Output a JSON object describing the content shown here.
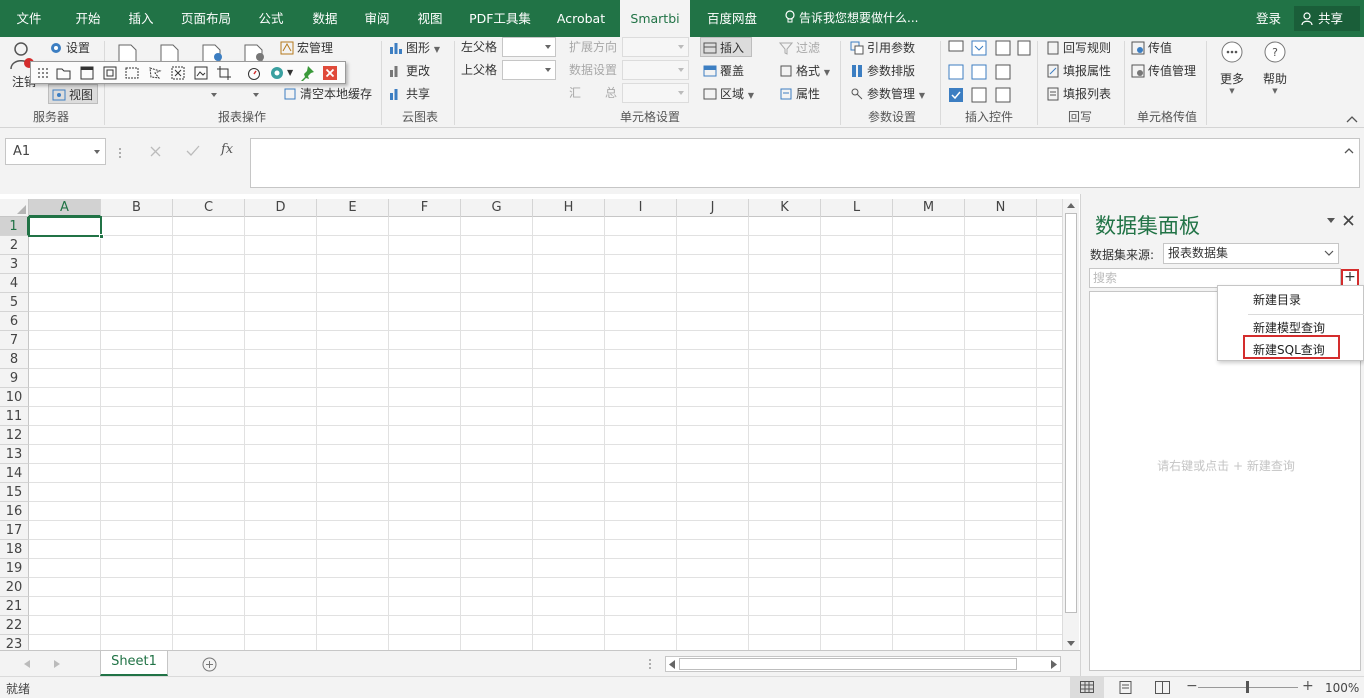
{
  "tabs": [
    "文件",
    "开始",
    "插入",
    "页面布局",
    "公式",
    "数据",
    "审阅",
    "视图",
    "PDF工具集",
    "Acrobat",
    "Smartbi",
    "百度网盘"
  ],
  "tell_me": "告诉我您想要做什么...",
  "login": "登录",
  "share": "共享",
  "ribbon": {
    "server": {
      "settings": "设置",
      "login_short": "注销",
      "view": "视图",
      "group": "服务器"
    },
    "report_ops": {
      "macro": "宏管理",
      "clear_cache": "清空本地缓存",
      "group": "报表操作"
    },
    "cloud": {
      "chart": "图形",
      "change": "更改",
      "share": "共享",
      "group": "云图表"
    },
    "cell": {
      "left_parent": "左父格",
      "up_parent": "上父格",
      "expand_dir": "扩展方向",
      "data_set": "数据设置",
      "sum_label": "汇　　总",
      "insert": "插入",
      "cover": "覆盖",
      "region": "区域",
      "filter": "过滤",
      "format": "格式",
      "attr": "属性",
      "group": "单元格设置"
    },
    "param": {
      "ref": "引用参数",
      "layout": "参数排版",
      "manage": "参数管理",
      "group": "参数设置"
    },
    "controls": {
      "group": "插入控件"
    },
    "writeback": {
      "rule": "回写规则",
      "attr": "填报属性",
      "list": "填报列表",
      "group": "回写"
    },
    "pass": {
      "pass": "传值",
      "manage": "传值管理",
      "group": "单元格传值"
    },
    "more": "更多",
    "help": "帮助"
  },
  "namebox": "A1",
  "fx": "fx",
  "columns": [
    "A",
    "B",
    "C",
    "D",
    "E",
    "F",
    "G",
    "H",
    "I",
    "J",
    "K",
    "L",
    "M",
    "N"
  ],
  "rows": [
    "1",
    "2",
    "3",
    "4",
    "5",
    "6",
    "7",
    "8",
    "9",
    "10",
    "11",
    "12",
    "13",
    "14",
    "15",
    "16",
    "17",
    "18",
    "19",
    "20",
    "21",
    "22",
    "23"
  ],
  "sheet": "Sheet1",
  "status": {
    "ready": "就绪",
    "zoom": "100%"
  },
  "panel": {
    "title": "数据集面板",
    "source_label": "数据集来源:",
    "source_value": "报表数据集",
    "search_placeholder": "搜索",
    "plus": "+",
    "hint": "请右键或点击 + 新建查询",
    "menu": [
      "新建目录",
      "新建模型查询",
      "新建SQL查询"
    ]
  }
}
